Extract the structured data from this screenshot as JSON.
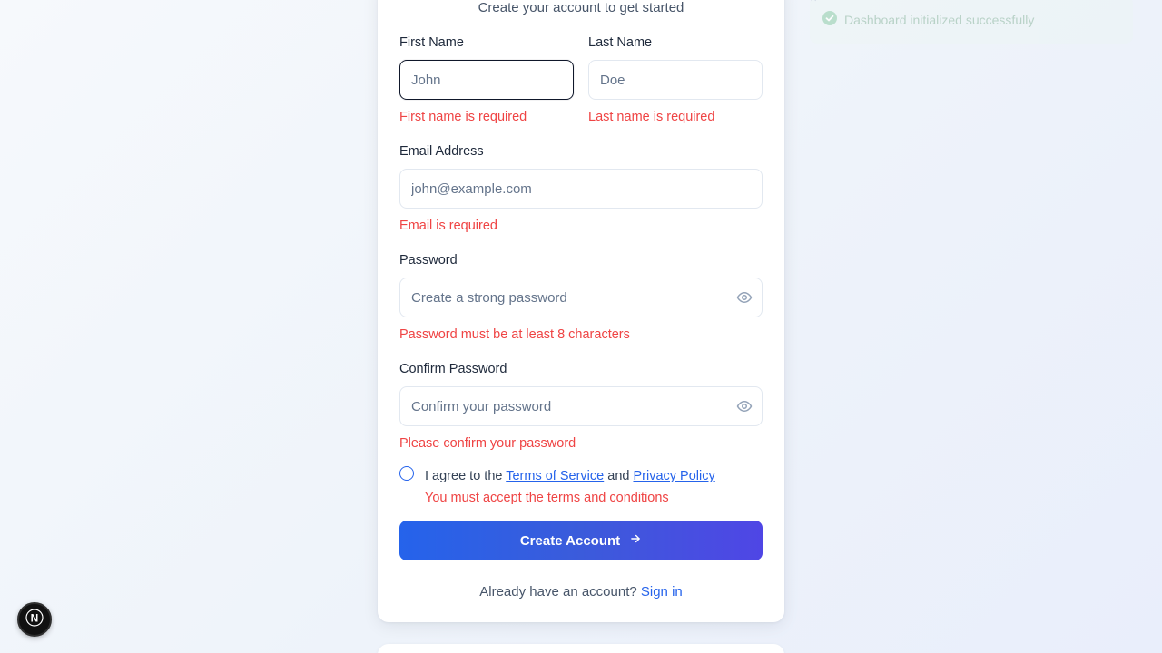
{
  "form": {
    "subtitle": "Create your account to get started",
    "first_name": {
      "label": "First Name",
      "placeholder": "John",
      "value": "",
      "error": "First name is required"
    },
    "last_name": {
      "label": "Last Name",
      "placeholder": "Doe",
      "value": "",
      "error": "Last name is required"
    },
    "email": {
      "label": "Email Address",
      "placeholder": "john@example.com",
      "value": "",
      "error": "Email is required"
    },
    "password": {
      "label": "Password",
      "placeholder": "Create a strong password",
      "value": "",
      "error": "Password must be at least 8 characters"
    },
    "confirm_password": {
      "label": "Confirm Password",
      "placeholder": "Confirm your password",
      "value": "",
      "error": "Please confirm your password"
    },
    "terms": {
      "prefix": "I agree to the",
      "terms_link": "Terms of Service",
      "and": "and",
      "privacy_link": "Privacy Policy",
      "error": "You must accept the terms and conditions",
      "checked": false
    },
    "submit_label": "Create Account",
    "signin_prompt": "Already have an account?",
    "signin_link": "Sign in"
  },
  "toast": {
    "message": "Dashboard initialized successfully",
    "status": "success",
    "color": "#a7c7b7"
  },
  "next_badge": {
    "letter": "N"
  },
  "colors": {
    "accent": "#2563eb",
    "error": "#ef4444",
    "gradient_end": "#4f46e5"
  }
}
